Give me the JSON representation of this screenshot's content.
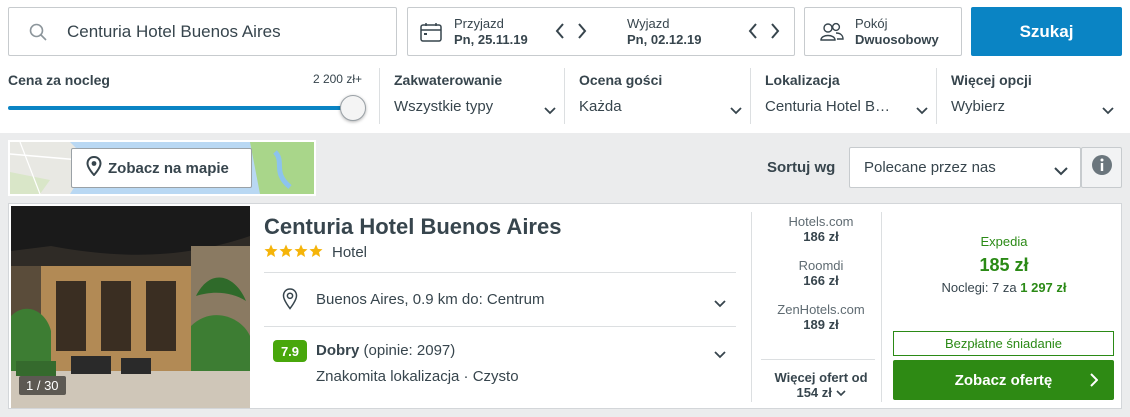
{
  "search": {
    "destination": "Centuria Hotel Buenos Aires",
    "button_label": "Szukaj"
  },
  "dates": {
    "checkin_label": "Przyjazd",
    "checkin_value": "Pn, 25.11.19",
    "checkout_label": "Wyjazd",
    "checkout_value": "Pn, 02.12.19"
  },
  "room": {
    "label": "Pokój",
    "value": "Dwuosobowy"
  },
  "filters": {
    "price": {
      "title": "Cena za nocleg",
      "max_label": "2 200 zł+",
      "level_percent": 100
    },
    "items": [
      {
        "title": "Zakwaterowanie",
        "value": "Wszystkie typy"
      },
      {
        "title": "Ocena gości",
        "value": "Każda"
      },
      {
        "title": "Lokalizacja",
        "value": "Centuria Hotel B…"
      },
      {
        "title": "Więcej opcji",
        "value": "Wybierz"
      }
    ]
  },
  "map": {
    "button_label": "Zobacz na mapie"
  },
  "sort": {
    "label": "Sortuj wg",
    "value": "Polecane przez nas"
  },
  "hotel": {
    "name": "Centuria Hotel Buenos Aires",
    "stars": 4,
    "type": "Hotel",
    "photo_count": "1 / 30",
    "location": "Buenos Aires, 0.9 km do: Centrum",
    "rating_score": "7.9",
    "rating_word": "Dobry",
    "rating_count": "(opinie: 2097)",
    "rating_tags": "Znakomita lokalizacja · Czysto"
  },
  "offers": [
    {
      "provider": "Hotels.com",
      "price": "186 zł"
    },
    {
      "provider": "Roomdi",
      "price": "166 zł"
    },
    {
      "provider": "ZenHotels.com",
      "price": "189 zł"
    }
  ],
  "more_offers": {
    "label": "Więcej ofert od",
    "price": "154 zł"
  },
  "best_offer": {
    "provider": "Expedia",
    "price": "185 zł",
    "nights_text": "Noclegi: 7 za",
    "nights_total": "1 297 zł",
    "breakfast": "Bezpłatne śniadanie",
    "button_label": "Zobacz ofertę"
  },
  "colors": {
    "accent_blue": "#0a84c4",
    "deal_green": "#2e8a14",
    "rating_green": "#48a70b",
    "star_yellow": "#f5b40a"
  }
}
